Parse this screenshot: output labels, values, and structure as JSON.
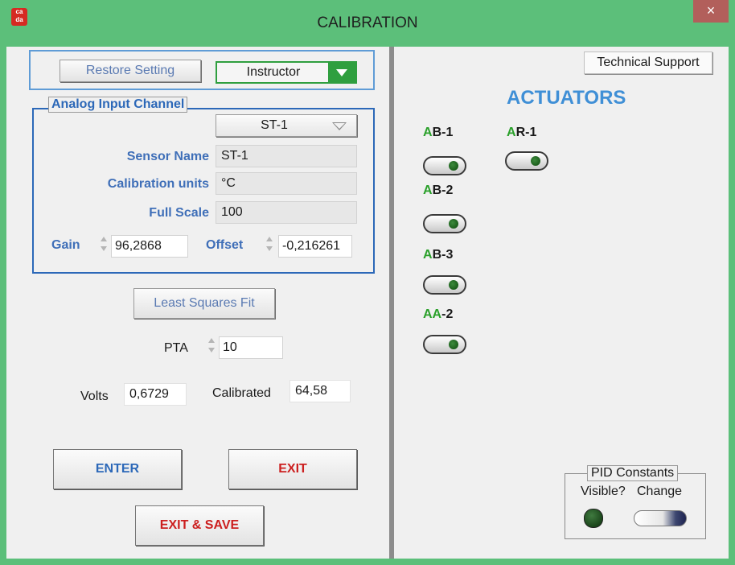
{
  "window": {
    "title": "CALIBRATION",
    "app_icon": "cada-logo-icon",
    "close": "×"
  },
  "top": {
    "restore_label": "Restore Setting",
    "mode_value": "Instructor"
  },
  "analog_input": {
    "legend": "Analog Input Channel",
    "channel_value": "ST-1",
    "sensor_name_label": "Sensor Name",
    "sensor_name_value": "ST-1",
    "units_label": "Calibration units",
    "units_value": "°C",
    "full_scale_label": "Full Scale",
    "full_scale_value": "100",
    "gain_label": "Gain",
    "gain_value": "96,2868",
    "offset_label": "Offset",
    "offset_value": "-0,216261"
  },
  "least_squares_label": "Least Squares  Fit",
  "pta": {
    "label": "PTA",
    "value": "10"
  },
  "readouts": {
    "volts_label": "Volts",
    "volts_value": "0,6729",
    "calibrated_label": "Calibrated",
    "calibrated_value": "64,58"
  },
  "buttons": {
    "enter": "ENTER",
    "exit": "EXIT",
    "exit_save": "EXIT & SAVE"
  },
  "right": {
    "tech_support": "Technical Support",
    "actuators_title": "ACTUATORS",
    "actuators": [
      {
        "prefix": "A",
        "rest": "B-1"
      },
      {
        "prefix": "A",
        "rest": "B-2"
      },
      {
        "prefix": "A",
        "rest": "B-3"
      },
      {
        "prefix": "AA",
        "rest": "-2"
      },
      {
        "prefix": "A",
        "rest": "R-1"
      }
    ],
    "pid": {
      "legend": "PID Constants",
      "visible_label": "Visible?",
      "change_label": "Change"
    }
  },
  "colors": {
    "accent_green": "#5cbf7a",
    "label_blue": "#3f6fb8",
    "exit_red": "#cc1f1f",
    "actuator_green": "#2aa02a"
  }
}
